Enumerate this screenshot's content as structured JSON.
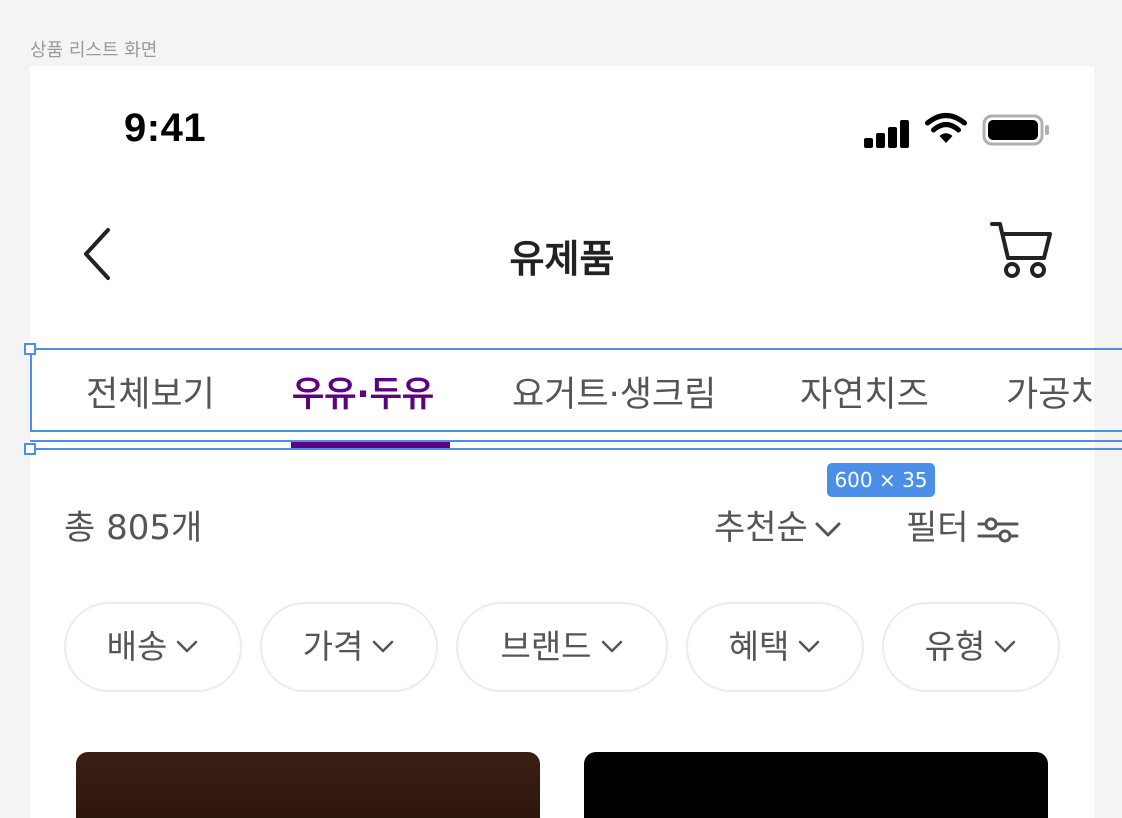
{
  "frame": {
    "label": "상품 리스트 화면"
  },
  "status_bar": {
    "time": "9:41"
  },
  "header": {
    "title": "유제품"
  },
  "tabs": [
    {
      "label": "전체보기",
      "active": false
    },
    {
      "label": "우유·두유",
      "active": true
    },
    {
      "label": "요거트·생크림",
      "active": false
    },
    {
      "label": "자연치즈",
      "active": false
    },
    {
      "label": "가공치",
      "active": false
    }
  ],
  "selection": {
    "size_label": "600 × 35"
  },
  "summary": {
    "total": "총 805개",
    "sort_label": "추천순",
    "filter_label": "필터"
  },
  "chips": [
    "배송",
    "가격",
    "브랜드",
    "혜택",
    "유형"
  ],
  "colors": {
    "accent": "#5f0080",
    "selection": "#4b8fe8"
  },
  "icons": [
    "back-arrow-icon",
    "cart-icon",
    "signal-icon",
    "wifi-icon",
    "battery-icon",
    "chevron-down-icon",
    "filter-sliders-icon"
  ]
}
